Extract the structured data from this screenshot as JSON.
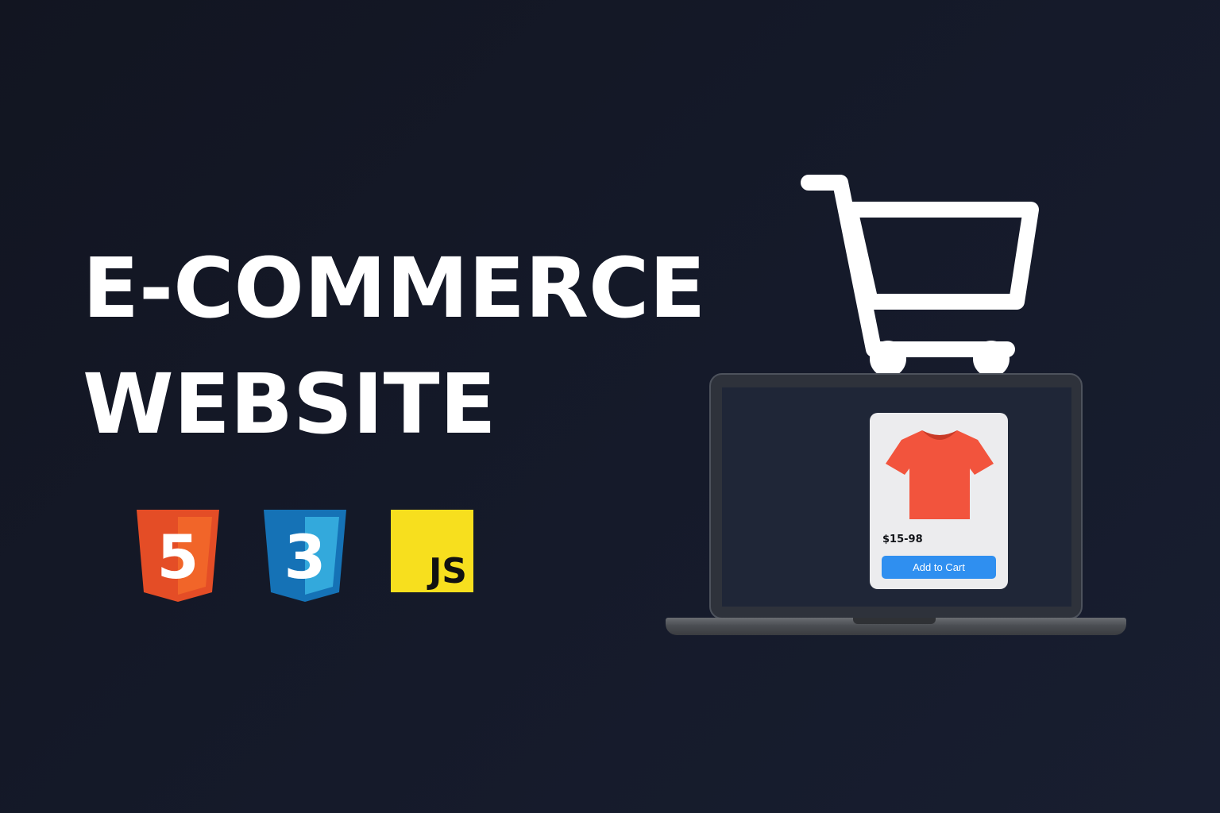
{
  "hero": {
    "title_line1": "E-COMMERCE",
    "title_line2": "WEBSITE"
  },
  "tech_logos": [
    {
      "name": "html5-logo",
      "icon": "html5-shield",
      "text": "5",
      "color": "#e44d26"
    },
    {
      "name": "css3-logo",
      "icon": "css3-shield",
      "text": "3",
      "color": "#1572b6"
    },
    {
      "name": "js-logo",
      "icon": "js-square",
      "text": "JS",
      "color": "#f7df1e"
    }
  ],
  "illustration": {
    "cart_icon": "shopping-cart-icon",
    "device": "laptop",
    "product_card": {
      "image_icon": "tshirt-icon",
      "image_color": "#f2543d",
      "price": "$15-98",
      "button_label": "Add to Cart",
      "button_color": "#2f8ff0"
    }
  }
}
